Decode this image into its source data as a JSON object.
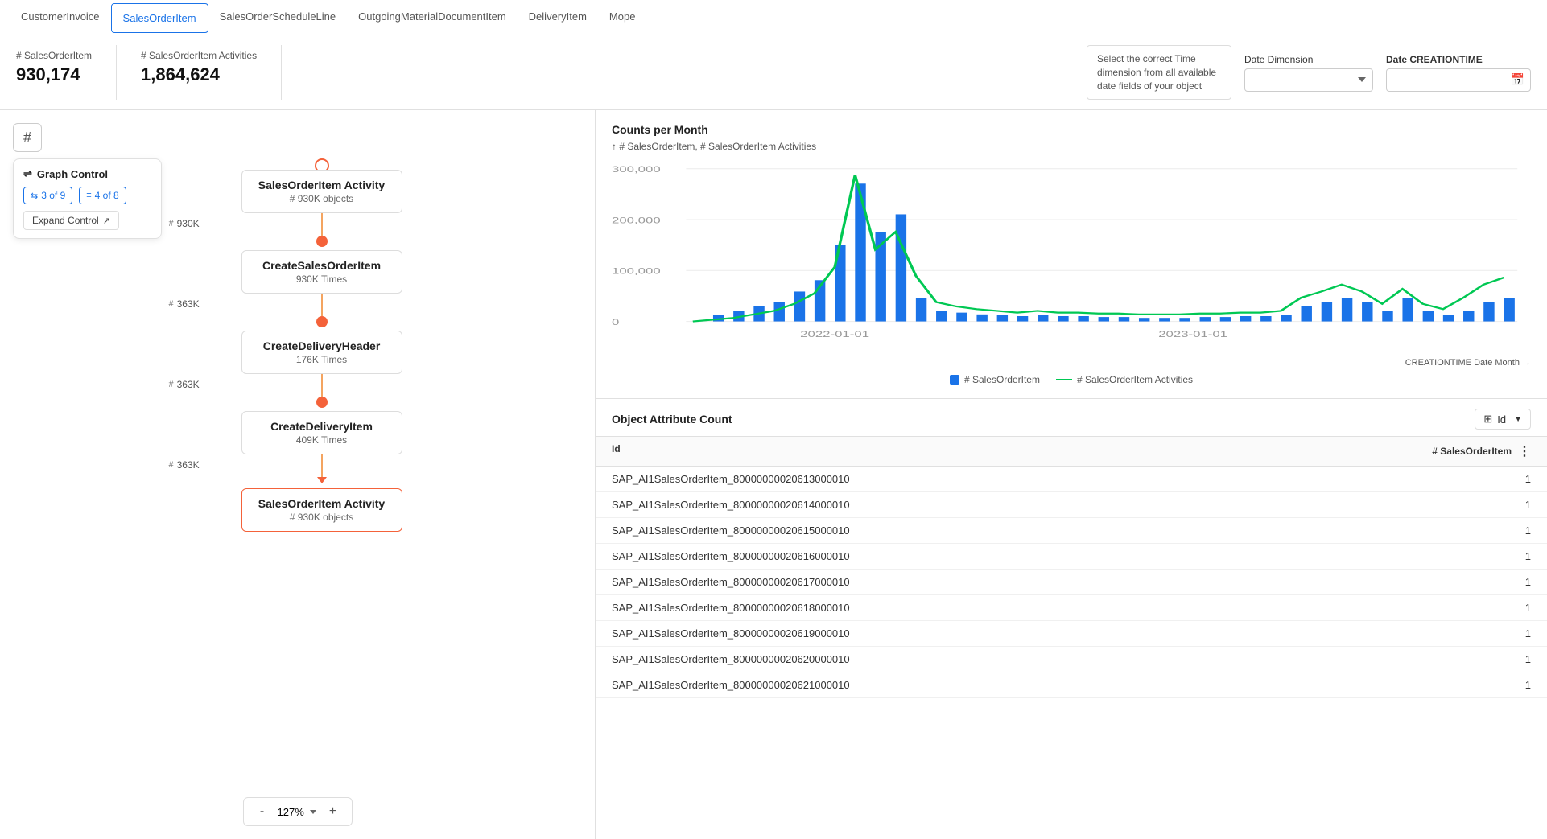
{
  "tabs": [
    {
      "id": "customer-invoice",
      "label": "CustomerInvoice",
      "active": false
    },
    {
      "id": "sales-order-item",
      "label": "SalesOrderItem",
      "active": true
    },
    {
      "id": "sales-order-schedule-line",
      "label": "SalesOrderScheduleLine",
      "active": false
    },
    {
      "id": "outgoing-material-document-item",
      "label": "OutgoingMaterialDocumentItem",
      "active": false
    },
    {
      "id": "delivery-item",
      "label": "DeliveryItem",
      "active": false
    },
    {
      "id": "mope",
      "label": "Mope",
      "active": false
    }
  ],
  "metrics": {
    "sales_order_item_label": "# SalesOrderItem",
    "sales_order_item_value": "930,174",
    "sales_order_item_activities_label": "# SalesOrderItem Activities",
    "sales_order_item_activities_value": "1,864,624"
  },
  "date_dimension": {
    "tooltip_text": "Select the correct Time dimension from all available date fields of your object",
    "label": "Date Dimension",
    "placeholder": "",
    "creation_label": "Date CREATIONTIME"
  },
  "graph_control": {
    "title": "Graph Control",
    "badge1": "3 of 9",
    "badge2": "4 of 8",
    "expand_label": "Expand Control"
  },
  "flow": {
    "nodes": [
      {
        "title": "SalesOrderItem Activity",
        "sub": "# 930K objects",
        "top": true
      },
      {
        "title": "CreateSalesOrderItem",
        "sub": "930K Times"
      },
      {
        "title": "CreateDeliveryHeader",
        "sub": "176K Times"
      },
      {
        "title": "CreateDeliveryItem",
        "sub": "409K Times"
      },
      {
        "title": "SalesOrderItem Activity",
        "sub": "# 930K objects",
        "bottom": true
      }
    ],
    "counts": [
      "930K",
      "363K",
      "363K",
      "363K"
    ],
    "zoom_level": "127%",
    "zoom_minus": "-",
    "zoom_plus": "+"
  },
  "chart": {
    "title": "Counts per Month",
    "subtitle": "↑ # SalesOrderItem, # SalesOrderItem Activities",
    "y_labels": [
      "300,000",
      "200,000",
      "100,000",
      "0"
    ],
    "x_labels": [
      "2022-01-01",
      "2023-01-01"
    ],
    "x_axis_label": "CREATIONTIME Date Month →",
    "legend": [
      {
        "label": "# SalesOrderItem",
        "type": "bar"
      },
      {
        "label": "# SalesOrderItem Activities",
        "type": "line"
      }
    ]
  },
  "object_attribute": {
    "title": "Object Attribute Count",
    "dropdown_label": "Id",
    "col_id": "Id",
    "col_count": "# SalesOrderItem",
    "rows": [
      {
        "id": "SAP_AI1SalesOrderItem_80000000020613000010",
        "count": "1"
      },
      {
        "id": "SAP_AI1SalesOrderItem_80000000020614000010",
        "count": "1"
      },
      {
        "id": "SAP_AI1SalesOrderItem_80000000020615000010",
        "count": "1"
      },
      {
        "id": "SAP_AI1SalesOrderItem_80000000020616000010",
        "count": "1"
      },
      {
        "id": "SAP_AI1SalesOrderItem_80000000020617000010",
        "count": "1"
      },
      {
        "id": "SAP_AI1SalesOrderItem_80000000020618000010",
        "count": "1"
      },
      {
        "id": "SAP_AI1SalesOrderItem_80000000020619000010",
        "count": "1"
      },
      {
        "id": "SAP_AI1SalesOrderItem_80000000020620000010",
        "count": "1"
      },
      {
        "id": "SAP_AI1SalesOrderItem_80000000020621000010",
        "count": "1"
      }
    ]
  }
}
